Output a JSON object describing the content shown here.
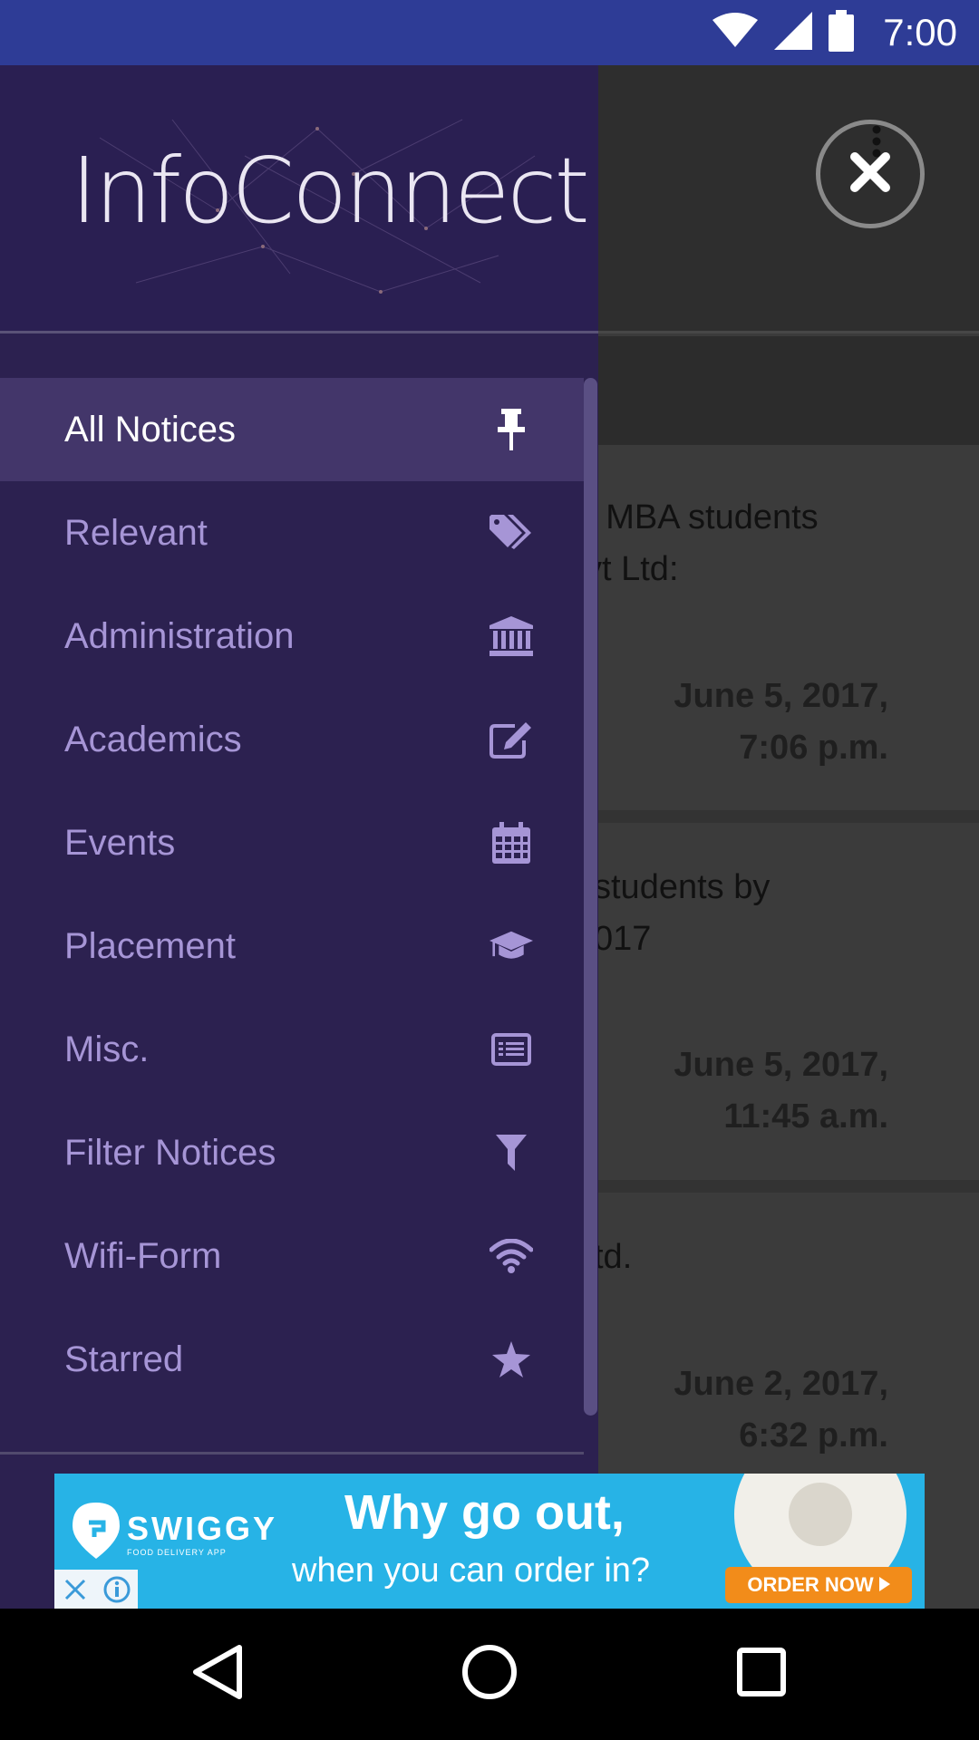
{
  "status_bar": {
    "time": "7:00"
  },
  "drawer": {
    "logo_text": "InfoConnect",
    "items": [
      {
        "label": "All Notices",
        "icon": "pin-icon",
        "active": true
      },
      {
        "label": "Relevant",
        "icon": "tags-icon"
      },
      {
        "label": "Administration",
        "icon": "bank-icon"
      },
      {
        "label": "Academics",
        "icon": "edit-icon"
      },
      {
        "label": "Events",
        "icon": "calendar-icon"
      },
      {
        "label": "Placement",
        "icon": "graduation-cap-icon"
      },
      {
        "label": "Misc.",
        "icon": "list-alt-icon"
      },
      {
        "label": "Filter Notices",
        "icon": "filter-icon"
      },
      {
        "label": "Wifi-Form",
        "icon": "wifi-icon"
      },
      {
        "label": "Starred",
        "icon": "star-icon"
      }
    ]
  },
  "background_notices": [
    {
      "text_line1": "r MBA students",
      "text_line2": "vt Ltd:",
      "date_line1": "June 5, 2017,",
      "date_line2": "7:06 p.m."
    },
    {
      "text_line1": "students by",
      "text_line2": "017",
      "date_line1": "June 5, 2017,",
      "date_line2": "11:45 a.m."
    },
    {
      "text_line1": "td.",
      "text_line2": "",
      "date_line1": "June 2, 2017,",
      "date_line2": "6:32 p.m."
    }
  ],
  "ad": {
    "brand": "SWIGGY",
    "brand_sub": "FOOD DELIVERY APP",
    "headline": "Why go out,",
    "subline": "when you can order in?",
    "cta": "ORDER NOW"
  },
  "colors": {
    "status_bar": "#2e3c96",
    "drawer_bg": "#2c2150",
    "active_item_bg": "#43366a",
    "item_text": "#a695d6",
    "ad_bg": "#27b3e6",
    "cta_bg": "#f28c1a"
  }
}
